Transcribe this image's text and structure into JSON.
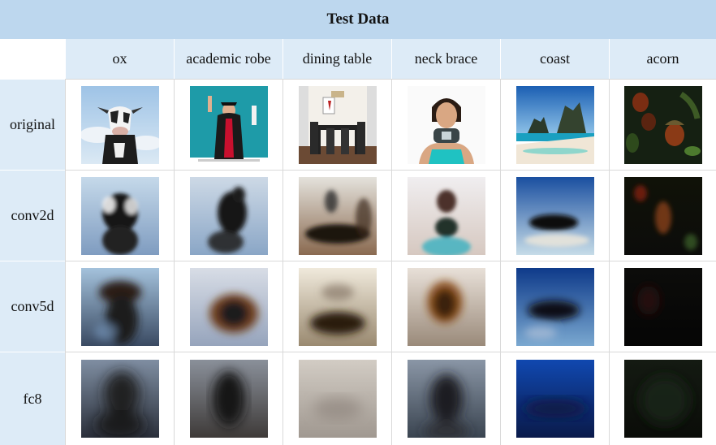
{
  "title": "Test Data",
  "columns": [
    "ox",
    "academic robe",
    "dining table",
    "neck brace",
    "coast",
    "acorn"
  ],
  "rows": [
    {
      "label": "original",
      "kind": "original"
    },
    {
      "label": "conv2d",
      "kind": "conv2d"
    },
    {
      "label": "conv5d",
      "kind": "conv5d"
    },
    {
      "label": "fc8",
      "kind": "fc8"
    }
  ]
}
